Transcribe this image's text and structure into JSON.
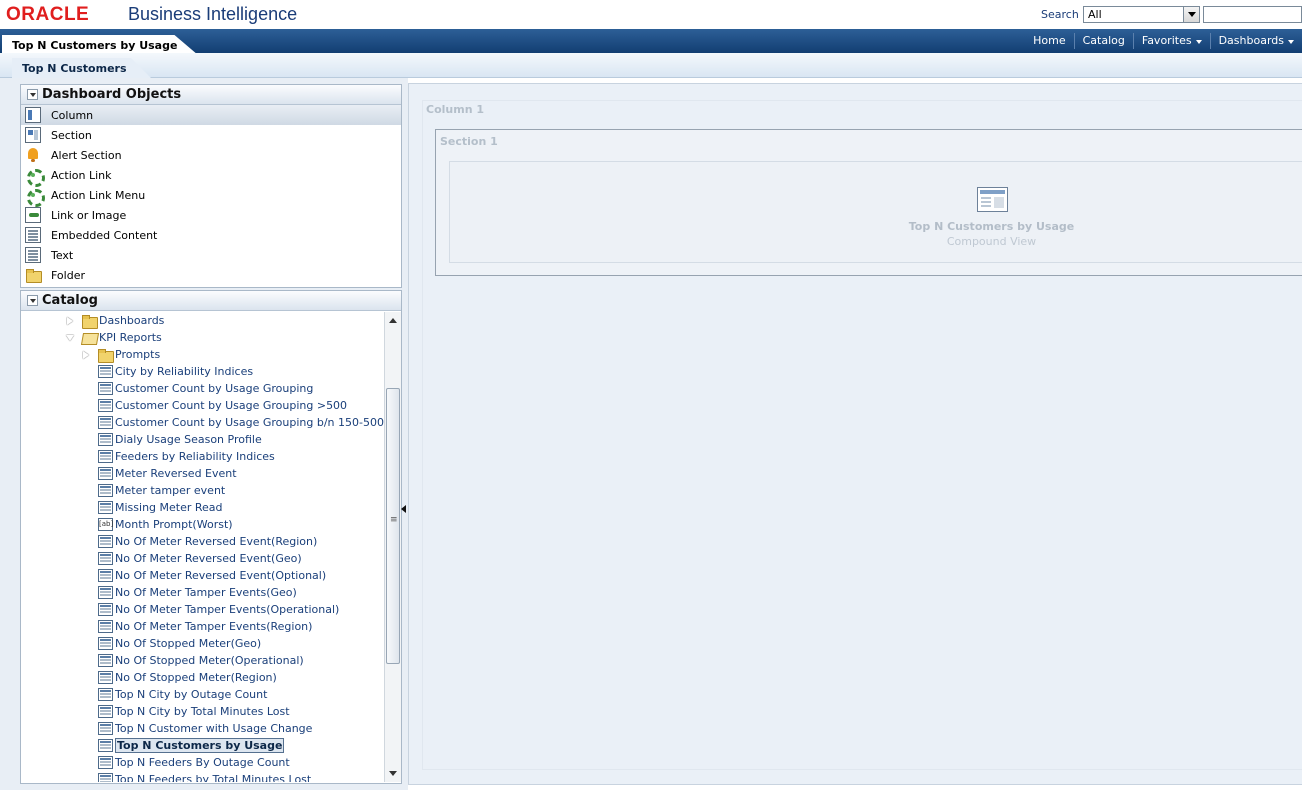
{
  "brand": {
    "logo": "ORACLE",
    "product": "Business Intelligence"
  },
  "search": {
    "label": "Search",
    "scope_value": "All",
    "query": ""
  },
  "header": {
    "page_tab": "Top N Customers by Usage",
    "nav": [
      {
        "label": "Home",
        "has_menu": false
      },
      {
        "label": "Catalog",
        "has_menu": false
      },
      {
        "label": "Favorites",
        "has_menu": true
      },
      {
        "label": "Dashboards",
        "has_menu": true
      }
    ]
  },
  "subtab": {
    "label": "Top N Customers"
  },
  "dashboard_objects": {
    "title": "Dashboard Objects",
    "items": [
      {
        "label": "Column",
        "icon": "column-icon"
      },
      {
        "label": "Section",
        "icon": "section-icon"
      },
      {
        "label": "Alert Section",
        "icon": "bell-icon"
      },
      {
        "label": "Action Link",
        "icon": "gear-icon"
      },
      {
        "label": "Action Link Menu",
        "icon": "gear-icon"
      },
      {
        "label": "Link or Image",
        "icon": "link-icon"
      },
      {
        "label": "Embedded Content",
        "icon": "document-icon"
      },
      {
        "label": "Text",
        "icon": "document-icon"
      },
      {
        "label": "Folder",
        "icon": "folder-icon"
      }
    ]
  },
  "catalog": {
    "title": "Catalog",
    "tree": [
      {
        "label": "Dashboards",
        "type": "folder",
        "level": 0,
        "state": "collapsed"
      },
      {
        "label": "KPI Reports",
        "type": "folder-open",
        "level": 0,
        "state": "expanded"
      },
      {
        "label": "Prompts",
        "type": "folder",
        "level": 1,
        "state": "collapsed"
      },
      {
        "label": "City by Reliability Indices",
        "type": "report",
        "level": 2
      },
      {
        "label": "Customer Count by Usage Grouping",
        "type": "report",
        "level": 2
      },
      {
        "label": "Customer Count by Usage Grouping >500",
        "type": "report",
        "level": 2
      },
      {
        "label": "Customer Count by Usage Grouping b/n 150-500",
        "type": "report",
        "level": 2
      },
      {
        "label": "Dialy Usage Season Profile",
        "type": "report",
        "level": 2
      },
      {
        "label": "Feeders by Reliability Indices",
        "type": "report",
        "level": 2
      },
      {
        "label": "Meter Reversed Event",
        "type": "report",
        "level": 2
      },
      {
        "label": "Meter tamper event",
        "type": "report",
        "level": 2
      },
      {
        "label": "Missing Meter Read",
        "type": "report",
        "level": 2
      },
      {
        "label": "Month Prompt(Worst)",
        "type": "prompt",
        "level": 2
      },
      {
        "label": "No Of Meter Reversed Event(Region)",
        "type": "report",
        "level": 2
      },
      {
        "label": "No Of Meter Reversed Event(Geo)",
        "type": "report",
        "level": 2
      },
      {
        "label": "No Of Meter Reversed Event(Optional)",
        "type": "report",
        "level": 2
      },
      {
        "label": "No Of Meter Tamper Events(Geo)",
        "type": "report",
        "level": 2
      },
      {
        "label": "No Of Meter Tamper Events(Operational)",
        "type": "report",
        "level": 2
      },
      {
        "label": "No Of Meter Tamper Events(Region)",
        "type": "report",
        "level": 2
      },
      {
        "label": "No Of Stopped Meter(Geo)",
        "type": "report",
        "level": 2
      },
      {
        "label": "No Of Stopped Meter(Operational)",
        "type": "report",
        "level": 2
      },
      {
        "label": "No Of Stopped Meter(Region)",
        "type": "report",
        "level": 2
      },
      {
        "label": "Top N City by Outage Count",
        "type": "report",
        "level": 2
      },
      {
        "label": "Top N City by Total Minutes Lost",
        "type": "report",
        "level": 2
      },
      {
        "label": "Top N Customer with Usage Change",
        "type": "report",
        "level": 2
      },
      {
        "label": "Top N Customers by Usage",
        "type": "report",
        "level": 2,
        "selected": true
      },
      {
        "label": "Top N Feeders By Outage Count",
        "type": "report",
        "level": 2
      },
      {
        "label": "Top N Feeders by Total Minutes Lost",
        "type": "report",
        "level": 2
      }
    ],
    "prompt_icon_text": "[ab]"
  },
  "canvas": {
    "column_label": "Column 1",
    "section_label": "Section 1",
    "view_title": "Top N Customers by Usage",
    "view_subtitle": "Compound View"
  },
  "colors": {
    "nav_bar": "#1e4a82",
    "oracle_red": "#e01e1e",
    "link_blue": "#1a3f7a"
  }
}
